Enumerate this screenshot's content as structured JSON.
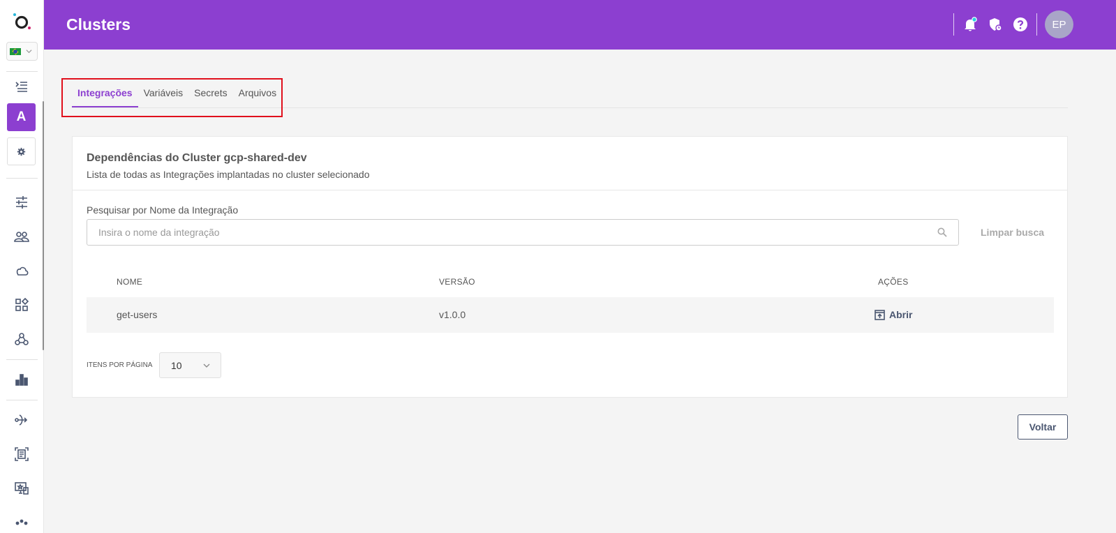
{
  "header": {
    "title": "Clusters",
    "user_initials": "EP",
    "brand_color": "#8c3fd0"
  },
  "sidebar": {
    "language": "pt-BR",
    "workspace_letter": "A",
    "icons": [
      "menu-expand-icon",
      "settings-icon",
      "sliders-icon",
      "users-icon",
      "cloud-icon",
      "apps-icon",
      "webhook-icon",
      "bar-chart-icon",
      "flow-icon",
      "document-scan-icon",
      "monitor-star-icon",
      "dots-icon"
    ]
  },
  "tabs": [
    {
      "label": "Integrações",
      "active": true
    },
    {
      "label": "Variáveis",
      "active": false
    },
    {
      "label": "Secrets",
      "active": false
    },
    {
      "label": "Arquivos",
      "active": false
    }
  ],
  "card": {
    "title": "Dependências do Cluster gcp-shared-dev",
    "subtitle": "Lista de todas as Integrações implantadas no cluster selecionado",
    "search": {
      "label": "Pesquisar por Nome da Integração",
      "placeholder": "Insira o nome da integração",
      "value": "",
      "clear_label": "Limpar busca"
    },
    "table": {
      "columns": [
        "NOME",
        "VERSÃO",
        "AÇÕES"
      ],
      "rows": [
        {
          "name": "get-users",
          "version": "v1.0.0",
          "action": "Abrir"
        }
      ]
    },
    "pagination": {
      "label": "ITENS POR PÁGINA",
      "value": "10"
    }
  },
  "footer": {
    "back_label": "Voltar"
  }
}
